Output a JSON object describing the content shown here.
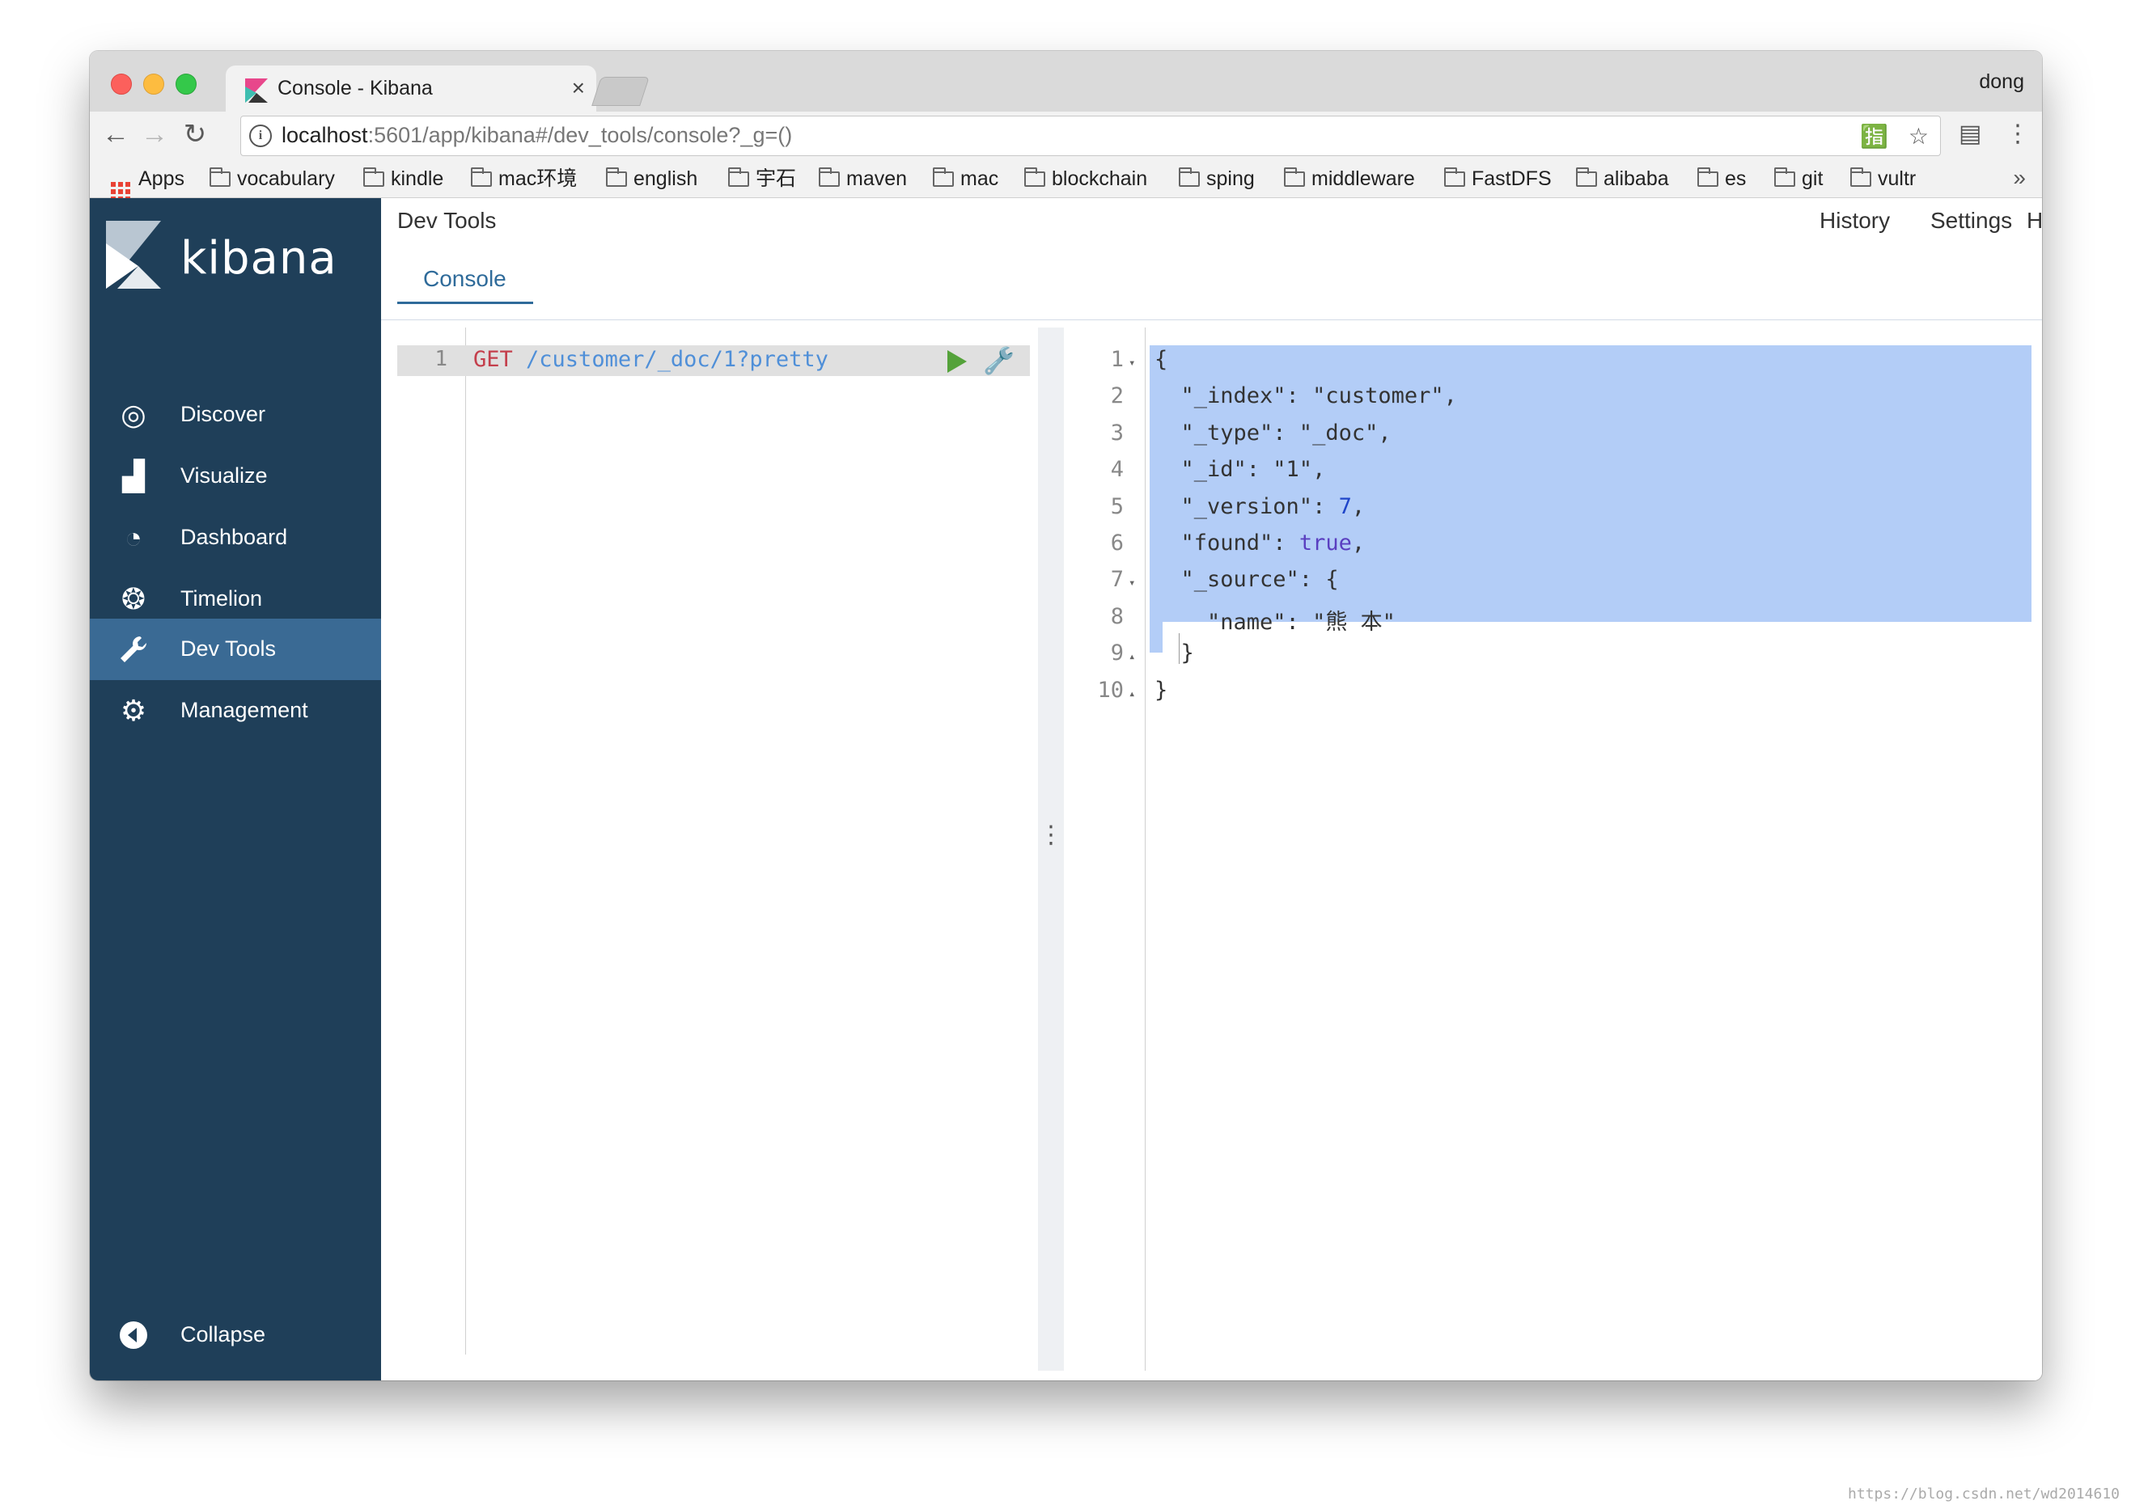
{
  "browser": {
    "tab_title": "Console - Kibana",
    "tab_close": "×",
    "user_name": "dong",
    "url_host": "localhost",
    "url_rest": ":5601/app/kibana#/dev_tools/console?_g=()",
    "nav_back": "←",
    "nav_forward": "→",
    "nav_reload": "↻",
    "star": "☆",
    "menu": "⋮",
    "bookmarks_more": "»",
    "bookmarks": [
      "Apps",
      "vocabulary",
      "kindle",
      "mac环境",
      "english",
      "宇石",
      "maven",
      "mac",
      "blockchain",
      "sping",
      "middleware",
      "FastDFS",
      "alibaba",
      "es",
      "git",
      "vultr"
    ]
  },
  "sidebar": {
    "brand": "kibana",
    "items": [
      {
        "label": "Discover",
        "icon": "compass-icon",
        "glyph": "◎"
      },
      {
        "label": "Visualize",
        "icon": "bar-chart-icon",
        "glyph": "▟"
      },
      {
        "label": "Dashboard",
        "icon": "dashboard-icon",
        "glyph": "◔"
      },
      {
        "label": "Timelion",
        "icon": "timelion-icon",
        "glyph": "❂"
      },
      {
        "label": "Dev Tools",
        "icon": "wrench-icon",
        "glyph": "🔧",
        "active": true
      },
      {
        "label": "Management",
        "icon": "gear-icon",
        "glyph": "⚙"
      }
    ],
    "collapse": {
      "label": "Collapse",
      "glyph": "◀"
    }
  },
  "main": {
    "title": "Dev Tools",
    "links": [
      "History",
      "Settings",
      "Help"
    ],
    "tab": "Console"
  },
  "editor": {
    "line_number": "1",
    "method": "GET",
    "path": " /customer/_doc/1?pretty"
  },
  "output": {
    "lines": [
      {
        "n": "1",
        "fold": "▾",
        "text": "{"
      },
      {
        "n": "2",
        "fold": "",
        "text": "  \"_index\": \"customer\","
      },
      {
        "n": "3",
        "fold": "",
        "text": "  \"_type\": \"_doc\","
      },
      {
        "n": "4",
        "fold": "",
        "text": "  \"_id\": \"1\","
      },
      {
        "n": "5",
        "fold": "",
        "text": "  \"_version\": 7,"
      },
      {
        "n": "6",
        "fold": "",
        "text": "  \"found\": true,"
      },
      {
        "n": "7",
        "fold": "▾",
        "text": "  \"_source\": {"
      },
      {
        "n": "8",
        "fold": "",
        "text": "    \"name\": \"熊 本\""
      },
      {
        "n": "9",
        "fold": "▴",
        "text": "  }"
      },
      {
        "n": "10",
        "fold": "▴",
        "text": "}"
      }
    ]
  },
  "watermark": "https://blog.csdn.net/wd2014610",
  "colors": {
    "sidebar_bg": "#1f3f59",
    "sidebar_active": "#3a6a94",
    "accent": "#2f6b9a",
    "selection": "#b3cdf7",
    "method": "#c43f4c",
    "path": "#4f8fd8"
  }
}
